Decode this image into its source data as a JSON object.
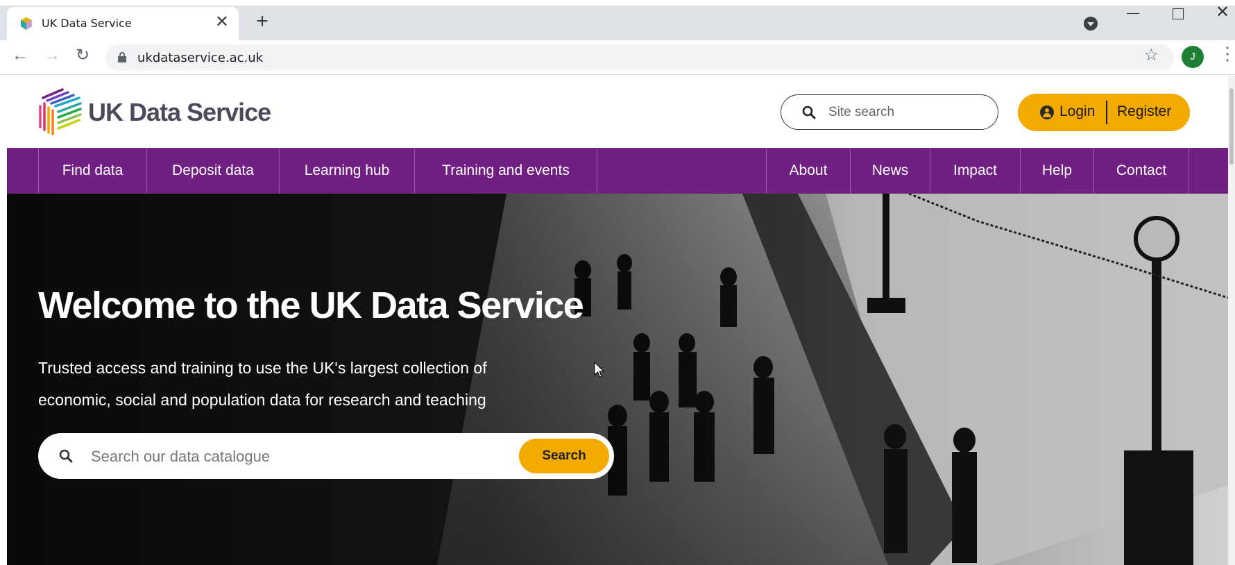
{
  "browser": {
    "tab_title": "UK Data Service",
    "url": "ukdataservice.ac.uk",
    "profile_initial": "J",
    "icons": {
      "tab_close": "close-icon",
      "new_tab": "plus-icon",
      "back": "arrow-left-icon",
      "forward": "arrow-right-icon",
      "reload": "reload-icon",
      "bookmark": "star-icon",
      "menu": "more-vert-icon"
    }
  },
  "header": {
    "logo_text": "UK Data Service",
    "site_search_placeholder": "Site search",
    "login_label": "Login",
    "register_label": "Register"
  },
  "nav": {
    "left": [
      "Find data",
      "Deposit data",
      "Learning hub",
      "Training and events"
    ],
    "right": [
      "About",
      "News",
      "Impact",
      "Help",
      "Contact"
    ]
  },
  "hero": {
    "title": "Welcome to the UK Data Service",
    "subtitle_line1": "Trusted access and training to use the UK's largest collection of",
    "subtitle_line2": "economic, social and population data for research and teaching",
    "search_placeholder": "Search our data catalogue",
    "search_button": "Search"
  },
  "colors": {
    "brand_purple": "#702082",
    "accent_gold": "#f2a900"
  }
}
